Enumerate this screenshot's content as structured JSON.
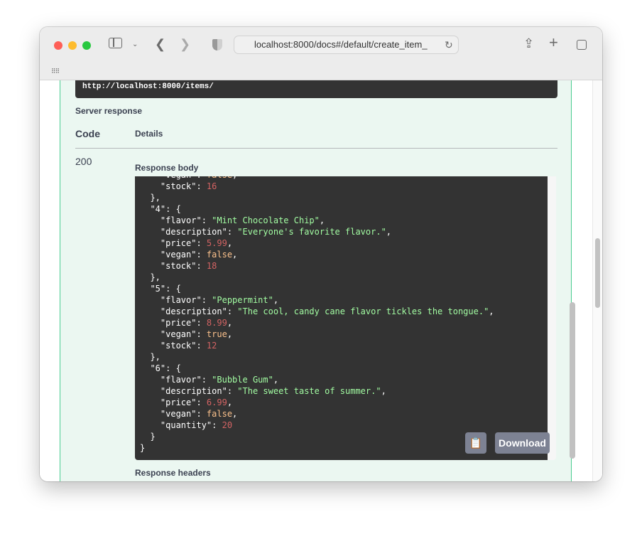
{
  "browser": {
    "url": "localhost:8000/docs#/default/create_item_",
    "icons": [
      "sidebar-icon",
      "chevron-down-icon",
      "back-icon",
      "forward-icon",
      "shield-icon",
      "reload-icon",
      "share-icon",
      "new-tab-icon",
      "tabs-overview-icon",
      "grid-icon"
    ]
  },
  "request_url": "http://localhost:8000/items/",
  "server_response_label": "Server response",
  "table": {
    "code_header": "Code",
    "details_header": "Details",
    "code": "200"
  },
  "response_body_label": "Response body",
  "response_body_lines": [
    [
      [
        "k",
        "    \"vegan\": "
      ],
      [
        "b",
        "false"
      ],
      [
        "k",
        ","
      ]
    ],
    [
      [
        "k",
        "    \"stock\": "
      ],
      [
        "n",
        "16"
      ]
    ],
    [
      [
        "k",
        "  },"
      ]
    ],
    [
      [
        "k",
        "  \"4\": {"
      ]
    ],
    [
      [
        "k",
        "    \"flavor\": "
      ],
      [
        "s",
        "\"Mint Chocolate Chip\""
      ],
      [
        "k",
        ","
      ]
    ],
    [
      [
        "k",
        "    \"description\": "
      ],
      [
        "s",
        "\"Everyone's favorite flavor.\""
      ],
      [
        "k",
        ","
      ]
    ],
    [
      [
        "k",
        "    \"price\": "
      ],
      [
        "n",
        "5.99"
      ],
      [
        "k",
        ","
      ]
    ],
    [
      [
        "k",
        "    \"vegan\": "
      ],
      [
        "b",
        "false"
      ],
      [
        "k",
        ","
      ]
    ],
    [
      [
        "k",
        "    \"stock\": "
      ],
      [
        "n",
        "18"
      ]
    ],
    [
      [
        "k",
        "  },"
      ]
    ],
    [
      [
        "k",
        "  \"5\": {"
      ]
    ],
    [
      [
        "k",
        "    \"flavor\": "
      ],
      [
        "s",
        "\"Peppermint\""
      ],
      [
        "k",
        ","
      ]
    ],
    [
      [
        "k",
        "    \"description\": "
      ],
      [
        "s",
        "\"The cool, candy cane flavor tickles the tongue.\""
      ],
      [
        "k",
        ","
      ]
    ],
    [
      [
        "k",
        "    \"price\": "
      ],
      [
        "n",
        "8.99"
      ],
      [
        "k",
        ","
      ]
    ],
    [
      [
        "k",
        "    \"vegan\": "
      ],
      [
        "b",
        "true"
      ],
      [
        "k",
        ","
      ]
    ],
    [
      [
        "k",
        "    \"stock\": "
      ],
      [
        "n",
        "12"
      ]
    ],
    [
      [
        "k",
        "  },"
      ]
    ],
    [
      [
        "k",
        "  \"6\": {"
      ]
    ],
    [
      [
        "k",
        "    \"flavor\": "
      ],
      [
        "s",
        "\"Bubble Gum\""
      ],
      [
        "k",
        ","
      ]
    ],
    [
      [
        "k",
        "    \"description\": "
      ],
      [
        "s",
        "\"The sweet taste of summer.\""
      ],
      [
        "k",
        ","
      ]
    ],
    [
      [
        "k",
        "    \"price\": "
      ],
      [
        "n",
        "6.99"
      ],
      [
        "k",
        ","
      ]
    ],
    [
      [
        "k",
        "    \"vegan\": "
      ],
      [
        "b",
        "false"
      ],
      [
        "k",
        ","
      ]
    ],
    [
      [
        "k",
        "    \"quantity\": "
      ],
      [
        "n",
        "20"
      ]
    ],
    [
      [
        "k",
        "  }"
      ]
    ],
    [
      [
        "k",
        "}"
      ]
    ]
  ],
  "copy_icon": "clipboard-icon",
  "download_label": "Download",
  "response_headers_label": "Response headers",
  "colors": {
    "string": "#a2fca2",
    "number": "#d36363",
    "boolean": "#fcc28c",
    "panel_border": "#49cc90",
    "panel_bg": "#ebf7f1"
  }
}
